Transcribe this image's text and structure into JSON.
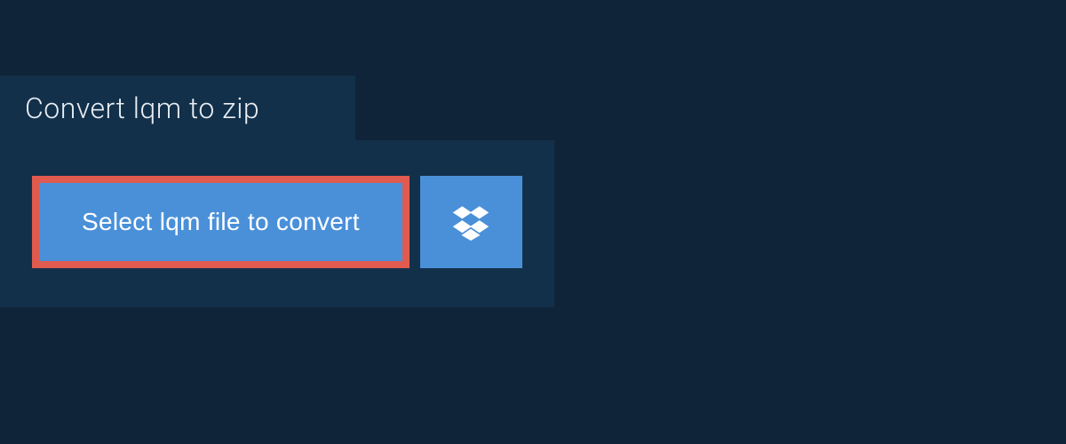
{
  "header": {
    "title": "Convert lqm to zip"
  },
  "actions": {
    "select_file_label": "Select lqm file to convert"
  },
  "colors": {
    "bg_dark": "#0f2438",
    "panel_bg": "#13304a",
    "button_bg": "#4a90d9",
    "button_border": "#e05a4f",
    "text_light": "#e8eef4",
    "text_white": "#ffffff"
  }
}
